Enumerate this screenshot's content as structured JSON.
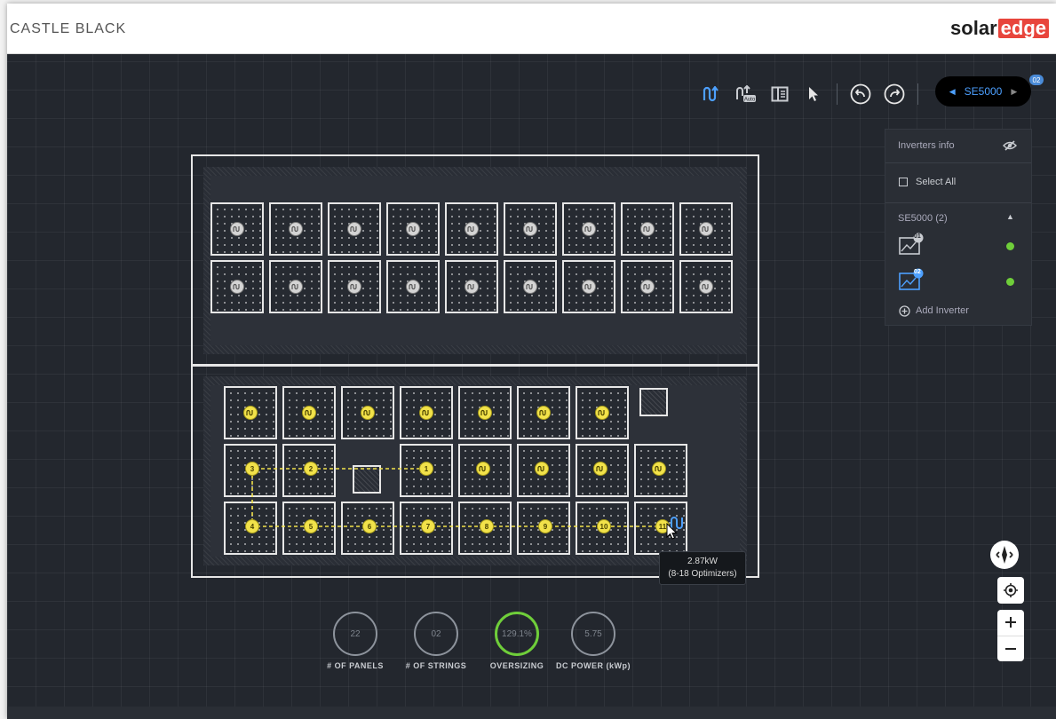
{
  "app": {
    "title": "CASTLE BLACK",
    "brand_left": "solar",
    "brand_right": "edge"
  },
  "toolbar": {
    "icons": [
      "string-tool-icon",
      "auto-string-icon",
      "inverter-panel-icon",
      "select-pointer-icon",
      "undo-icon",
      "redo-icon"
    ]
  },
  "inverter_selector": {
    "label": "SE5000",
    "badge": "02"
  },
  "inverters_panel": {
    "title": "Inverters info",
    "select_all": "Select All",
    "group": "SE5000 (2)",
    "items": [
      {
        "badge": "01",
        "status": "ok"
      },
      {
        "badge": "02",
        "status": "ok"
      }
    ],
    "add": "Add Inverter"
  },
  "string": {
    "labels": [
      "1",
      "2",
      "3",
      "4",
      "5",
      "6",
      "7",
      "8",
      "9",
      "10",
      "11"
    ]
  },
  "tooltip": {
    "power": "2.87kW",
    "range": "(8-18 Optimizers)"
  },
  "stats": {
    "panels": {
      "value": "22",
      "label": "# OF PANELS"
    },
    "strings": {
      "value": "02",
      "label": "# OF STRINGS"
    },
    "oversizing": {
      "value": "129.1%",
      "label": "OVERSIZING"
    },
    "dc_power": {
      "value": "5.75",
      "label": "DC POWER (kWp)"
    }
  },
  "colors": {
    "accent": "#4da0ff",
    "string_yellow": "#f2e24a",
    "ok_green": "#6fce3a",
    "brand_red": "#e8453c"
  }
}
